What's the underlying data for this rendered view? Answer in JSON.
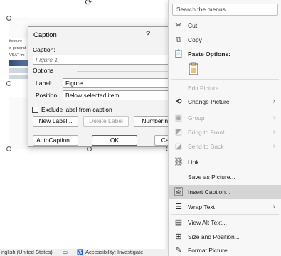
{
  "document": {
    "image_lines": [
      "itecture",
      "d generat",
      "VSAT Im"
    ]
  },
  "dialog": {
    "title": "Caption",
    "help": "?",
    "caption_label": "Caption:",
    "caption_value": "Figure 1",
    "options_label": "Options",
    "label_label": "Label:",
    "label_value": "Figure",
    "position_label": "Position:",
    "position_value": "Below selected item",
    "exclude_label": "Exclude label from caption",
    "exclude_checked": false,
    "new_label_button": "New Label...",
    "delete_label_button": "Delete Label",
    "numbering_button": "Numbering",
    "autocaption_button": "AutoCaption...",
    "ok_button": "OK",
    "cancel_button": "Cancel"
  },
  "context_menu": {
    "search_placeholder": "Search the menus",
    "items": [
      {
        "label": "Cut",
        "icon": "scissors-icon",
        "state": "enabled"
      },
      {
        "label": "Copy",
        "icon": "copy-icon",
        "state": "enabled"
      },
      {
        "label": "Paste Options:",
        "icon": "paste-icon",
        "state": "header"
      },
      {
        "label": "Edit Picture",
        "state": "disabled"
      },
      {
        "label": "Change Picture",
        "icon": "change-picture-icon",
        "state": "enabled",
        "submenu": true
      },
      {
        "label": "Group",
        "icon": "group-icon",
        "state": "disabled",
        "submenu": true
      },
      {
        "label": "Bring to Front",
        "icon": "bring-front-icon",
        "state": "disabled",
        "submenu": true
      },
      {
        "label": "Send to Back",
        "icon": "send-back-icon",
        "state": "disabled",
        "submenu": true
      },
      {
        "label": "Link",
        "icon": "link-icon",
        "state": "enabled"
      },
      {
        "label": "Save as Picture...",
        "state": "enabled"
      },
      {
        "label": "Insert Caption...",
        "icon": "insert-caption-icon",
        "state": "highlighted"
      },
      {
        "label": "Wrap Text",
        "icon": "wrap-text-icon",
        "state": "enabled",
        "submenu": true
      },
      {
        "label": "View Alt Text...",
        "icon": "alt-text-icon",
        "state": "enabled"
      },
      {
        "label": "Size and Position...",
        "icon": "size-position-icon",
        "state": "enabled"
      },
      {
        "label": "Format Picture...",
        "icon": "format-picture-icon",
        "state": "enabled"
      }
    ]
  },
  "status_bar": {
    "language": "nglish (United States)",
    "accessibility": "Accessibility: Investigate"
  },
  "colors": {
    "highlight": "#d5d5d5",
    "primary_border": "#1a6fc9",
    "disabled_text": "#a6a6a6"
  }
}
